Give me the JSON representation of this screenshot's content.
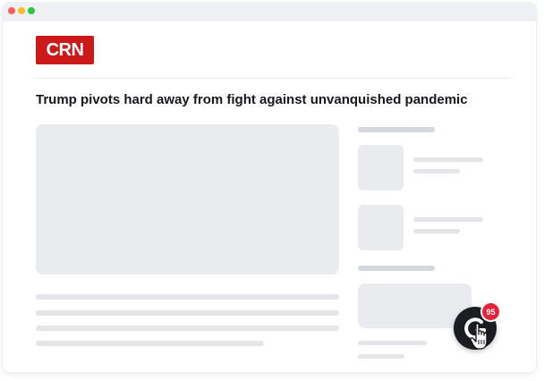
{
  "brand": {
    "logo_text": "CRN",
    "logo_color": "#cc1a1a"
  },
  "article": {
    "headline": "Trump pivots hard away from fight against unvanquished pandemic"
  },
  "widget": {
    "badge_count": "95",
    "icon": "refresh-g-icon",
    "badge_color": "#e5223a"
  },
  "window_controls": [
    "close",
    "minimize",
    "maximize"
  ]
}
